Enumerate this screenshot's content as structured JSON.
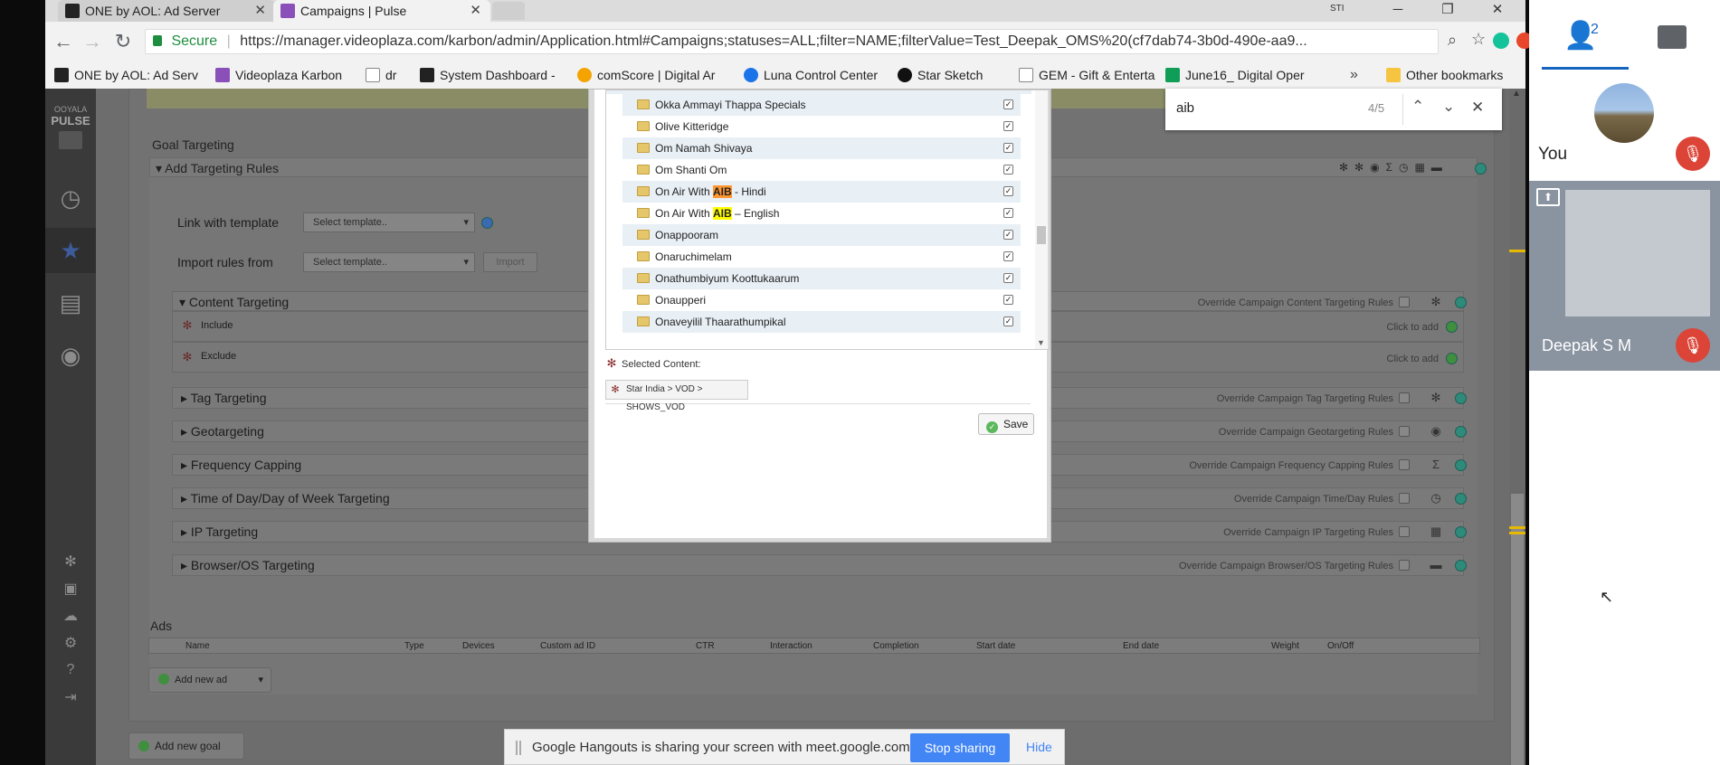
{
  "browser": {
    "tabs": [
      {
        "title": "ONE by AOL: Ad Server"
      },
      {
        "title": "Campaigns | Pulse"
      }
    ],
    "secure_label": "Secure",
    "url": "https://manager.videoplaza.com/karbon/admin/Application.html#Campaigns;statuses=ALL;filter=NAME;filterValue=Test_Deepak_OMS%20(cf7dab74-3b0d-490e-aa9...",
    "bookmarks": [
      "ONE by AOL: Ad Serv",
      "Videoplaza Karbon",
      "dr",
      "System Dashboard -",
      "comScore | Digital Ar",
      "Luna Control Center",
      "Star Sketch",
      "GEM - Gift & Enterta",
      "June16_ Digital Oper",
      "Other bookmarks"
    ],
    "bookmarks_overflow": "»",
    "profile_badge": "STI"
  },
  "find": {
    "query": "aib",
    "count": "4/5"
  },
  "app": {
    "logo_line1": "OOYALA",
    "logo_line2": "PULSE",
    "goal_targeting_title": "Goal Targeting",
    "add_targeting_rules": "Add Targeting Rules",
    "link_with_template": "Link with template",
    "import_rules_from": "Import rules from",
    "select_template": "Select template..",
    "import_btn": "Import",
    "content_targeting": "Content Targeting",
    "content_override": "Override Campaign Content Targeting Rules",
    "include": "Include",
    "exclude": "Exclude",
    "click_to_add": "Click to add",
    "sections": [
      {
        "label": "Tag Targeting",
        "override": "Override Campaign Tag Targeting Rules"
      },
      {
        "label": "Geotargeting",
        "override": "Override Campaign Geotargeting Rules"
      },
      {
        "label": "Frequency Capping",
        "override": "Override Campaign Frequency Capping Rules"
      },
      {
        "label": "Time of Day/Day of Week Targeting",
        "override": "Override Campaign Time/Day Rules"
      },
      {
        "label": "IP Targeting",
        "override": "Override Campaign IP Targeting Rules"
      },
      {
        "label": "Browser/OS Targeting",
        "override": "Override Campaign Browser/OS Targeting Rules"
      }
    ],
    "ads_title": "Ads",
    "ads_columns": [
      "Name",
      "Type",
      "Devices",
      "Custom ad ID",
      "CTR",
      "Interaction",
      "Completion",
      "Start date",
      "End date",
      "Weight",
      "On/Off"
    ],
    "add_new_ad": "Add new ad",
    "add_new_goal": "Add new goal"
  },
  "modal": {
    "items": [
      {
        "pre": "Okka Ammayi Thappa Specials",
        "hl": "",
        "post": ""
      },
      {
        "pre": "Olive Kitteridge",
        "hl": "",
        "post": ""
      },
      {
        "pre": "Om Namah Shivaya",
        "hl": "",
        "post": ""
      },
      {
        "pre": "Om Shanti Om",
        "hl": "",
        "post": ""
      },
      {
        "pre": "On Air With ",
        "hl": "AIB",
        "post": " - Hindi"
      },
      {
        "pre": "On Air With ",
        "hl": "AIB",
        "post": " – English"
      },
      {
        "pre": "Onappooram",
        "hl": "",
        "post": ""
      },
      {
        "pre": "Onaruchimelam",
        "hl": "",
        "post": ""
      },
      {
        "pre": "Onathumbiyum Koottukaarum",
        "hl": "",
        "post": ""
      },
      {
        "pre": "Onaupperi",
        "hl": "",
        "post": ""
      },
      {
        "pre": "Onaveyilil Thaarathumpikal",
        "hl": "",
        "post": ""
      }
    ],
    "selected_label": "Selected Content:",
    "selected_path": "Star India > VOD > SHOWS_VOD",
    "save": "Save"
  },
  "hangouts": {
    "participants_count": "2",
    "you": "You",
    "participant2": "Deepak S M",
    "share_msg": "Google Hangouts is sharing your screen with meet.google.com.",
    "stop_sharing": "Stop sharing",
    "hide": "Hide"
  }
}
